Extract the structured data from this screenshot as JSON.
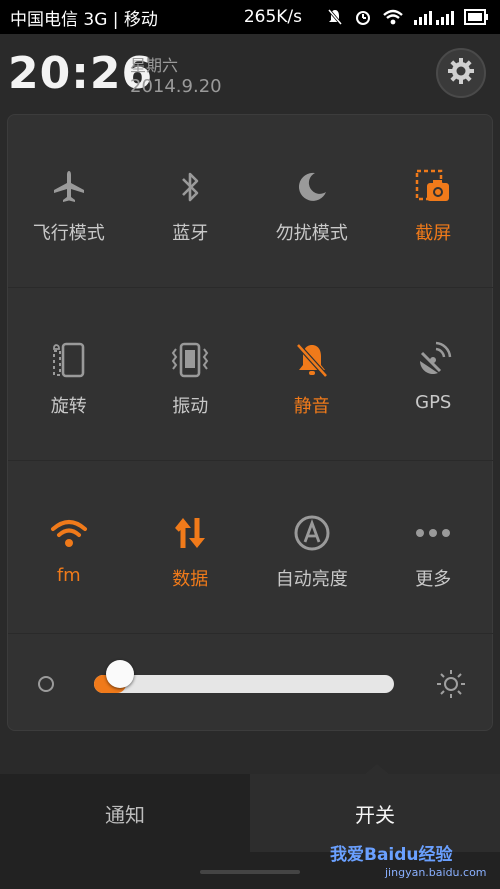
{
  "status_bar": {
    "carrier": "中国电信 3G | 移动",
    "speed": "265K/s",
    "battery_icon": "battery-icon"
  },
  "header": {
    "time": "20:26",
    "weekday": "星期六",
    "date": "2014.9.20"
  },
  "tiles": [
    [
      {
        "label": "飞行模式",
        "icon": "airplane-icon",
        "active": false
      },
      {
        "label": "蓝牙",
        "icon": "bluetooth-icon",
        "active": false
      },
      {
        "label": "勿扰模式",
        "icon": "moon-icon",
        "active": false
      },
      {
        "label": "截屏",
        "icon": "screenshot-icon",
        "active": true
      }
    ],
    [
      {
        "label": "旋转",
        "icon": "rotate-icon",
        "active": false
      },
      {
        "label": "振动",
        "icon": "vibrate-icon",
        "active": false
      },
      {
        "label": "静音",
        "icon": "mute-icon",
        "active": true
      },
      {
        "label": "GPS",
        "icon": "gps-icon",
        "active": false
      }
    ],
    [
      {
        "label": "fm",
        "icon": "wifi-icon",
        "active": true
      },
      {
        "label": "数据",
        "icon": "data-icon",
        "active": true
      },
      {
        "label": "自动亮度",
        "icon": "auto-brightness-icon",
        "active": false
      },
      {
        "label": "更多",
        "icon": "more-icon",
        "active": false
      }
    ]
  ],
  "brightness": {
    "level": 0.06
  },
  "tabs": [
    {
      "label": "通知",
      "selected": false
    },
    {
      "label": "开关",
      "selected": true
    }
  ],
  "watermark": {
    "text": "我爱Baidu经验",
    "url_text": "jingyan.baidu.com"
  },
  "colors": {
    "accent": "#f07a1a",
    "inactive": "#c8c8c8"
  }
}
